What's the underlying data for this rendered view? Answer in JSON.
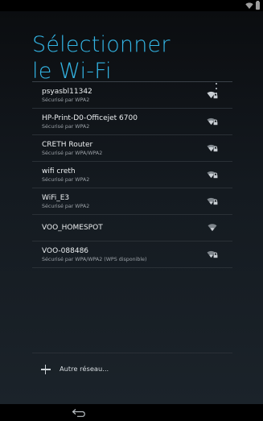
{
  "status_bar": {
    "icons": [
      "wifi-icon",
      "battery-icon"
    ]
  },
  "header": {
    "title_line1": "Sélectionner",
    "title_line2": "le Wi-Fi",
    "menu_icon": "overflow-menu-icon"
  },
  "networks": [
    {
      "ssid": "psyasbl11342",
      "security": "Sécurisé par WPA2",
      "secured": true
    },
    {
      "ssid": "HP-Print-D0-Officejet 6700",
      "security": "Sécurisé par WPA2",
      "secured": true
    },
    {
      "ssid": "CRETH Router",
      "security": "Sécurisé par WPA/WPA2",
      "secured": true
    },
    {
      "ssid": "wifi creth",
      "security": "Sécurisé par WPA2",
      "secured": true
    },
    {
      "ssid": "WiFi_E3",
      "security": "Sécurisé par WPA2",
      "secured": true
    },
    {
      "ssid": "VOO_HOMESPOT",
      "security": "",
      "secured": false
    },
    {
      "ssid": "VOO-088486",
      "security": "Sécurisé par WPA/WPA2 (WPS disponible)",
      "secured": true
    }
  ],
  "add_network": {
    "label": "Autre réseau..."
  },
  "nav_bar": {
    "icons": [
      "back-icon"
    ]
  },
  "colors": {
    "accent": "#33b5e5",
    "text": "#eceff1",
    "subtext": "#9aa0a6"
  }
}
